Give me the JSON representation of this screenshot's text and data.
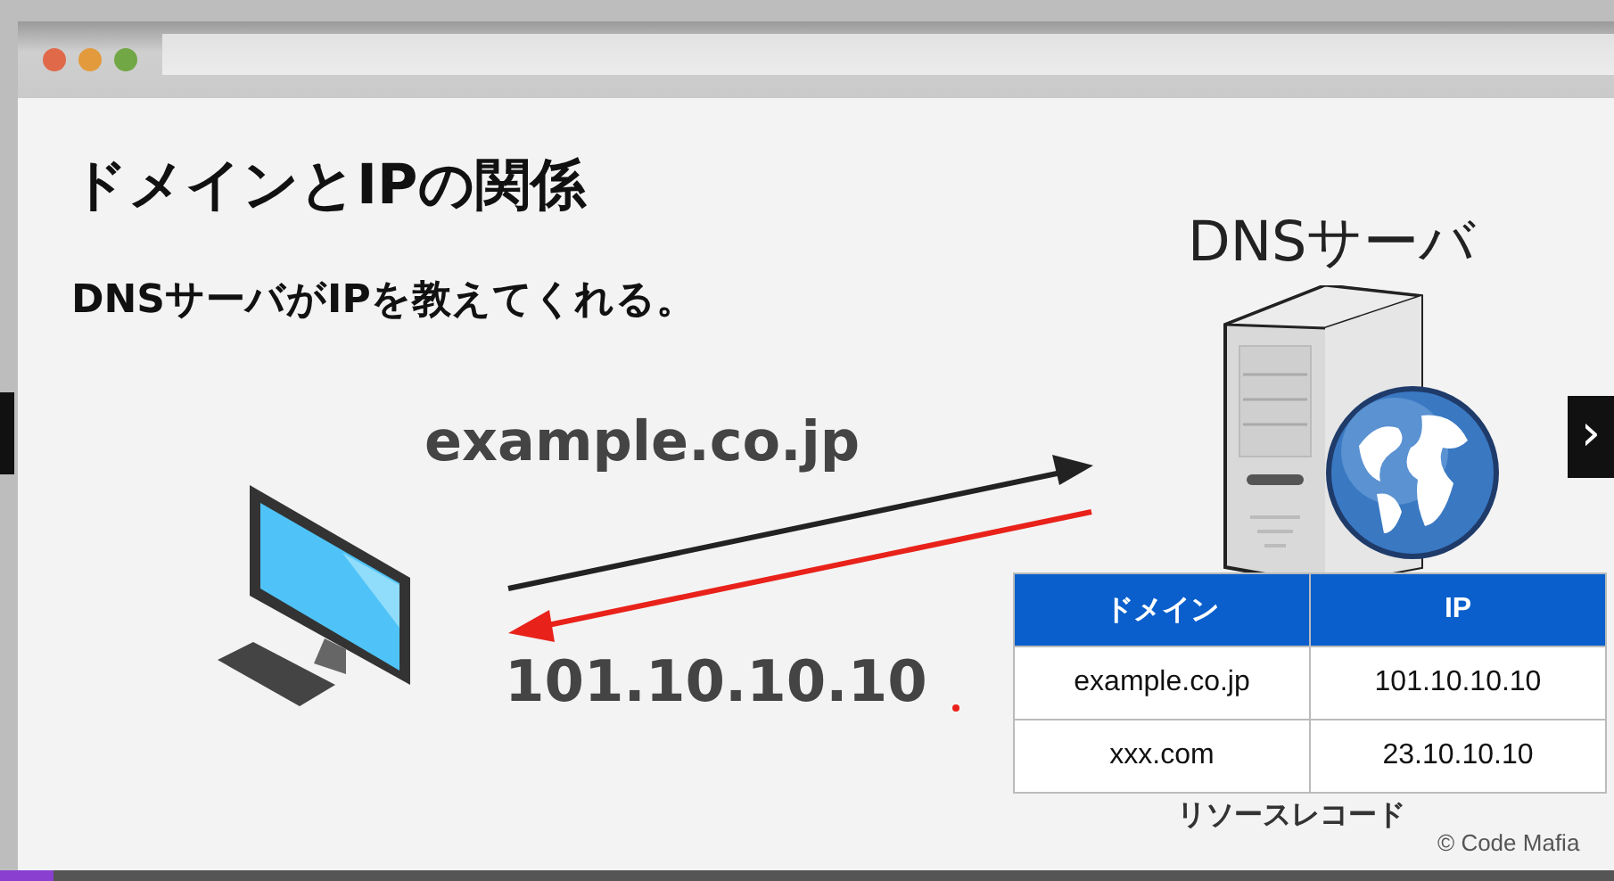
{
  "slide": {
    "title": "ドメインとIPの関係",
    "subtitle": "DNSサーバがIPを教えてくれる。",
    "server_label": "DNSサーバ",
    "request_label": "example.co.jp",
    "response_label": "101.10.10.10",
    "table": {
      "columns": [
        "ドメイン",
        "IP"
      ],
      "rows": [
        [
          "example.co.jp",
          "101.10.10.10"
        ],
        [
          "xxx.com",
          "23.10.10.10"
        ]
      ]
    },
    "caption": "リソースレコード",
    "credit": "© Code Mafia"
  },
  "player": {
    "next_button": "›",
    "progress": {
      "level": 0.033
    }
  }
}
